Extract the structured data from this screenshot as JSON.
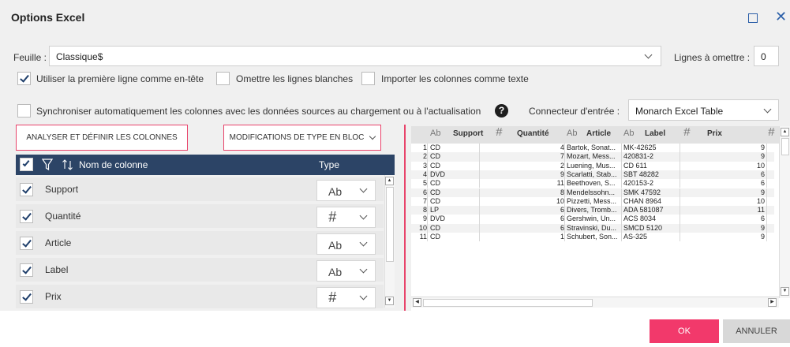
{
  "window": {
    "title": "Options Excel"
  },
  "sheet": {
    "label": "Feuille :",
    "value": "Classique$"
  },
  "skip_lines": {
    "label": "Lignes à omettre :",
    "value": "0"
  },
  "options": {
    "use_header": {
      "label": "Utiliser la première ligne comme en-tête",
      "checked": true
    },
    "skip_blank": {
      "label": "Omettre les lignes blanches",
      "checked": false
    },
    "import_text": {
      "label": "Importer les colonnes comme texte",
      "checked": false
    },
    "sync_columns": {
      "label": "Synchroniser automatiquement les colonnes avec les données sources au chargement ou à l'actualisation",
      "checked": false
    }
  },
  "connector": {
    "label": "Connecteur d'entrée :",
    "value": "Monarch Excel Table"
  },
  "buttons": {
    "analyze": "ANALYSER ET DÉFINIR LES COLONNES",
    "bulk_type": "MODIFICATIONS DE TYPE EN BLOC",
    "ok": "OK",
    "cancel": "ANNULER"
  },
  "column_list": {
    "header_name": "Nom de colonne",
    "header_type": "Type",
    "rows": [
      {
        "name": "Support",
        "type": "Ab"
      },
      {
        "name": "Quantité",
        "type": "#"
      },
      {
        "name": "Article",
        "type": "Ab"
      },
      {
        "name": "Label",
        "type": "Ab"
      },
      {
        "name": "Prix",
        "type": "#"
      }
    ]
  },
  "preview": {
    "columns": [
      {
        "type": "Ab",
        "name": "Support"
      },
      {
        "type": "#",
        "name": "Quantité"
      },
      {
        "type": "Ab",
        "name": "Article"
      },
      {
        "type": "Ab",
        "name": "Label"
      },
      {
        "type": "#",
        "name": "Prix"
      },
      {
        "type": "#",
        "name": ""
      }
    ],
    "rows": [
      [
        "1",
        "CD",
        "4",
        "Bartok, Sonat...",
        "MK-42625",
        "9"
      ],
      [
        "2",
        "CD",
        "7",
        "Mozart, Mess...",
        "420831-2",
        "9"
      ],
      [
        "3",
        "CD",
        "2",
        "Luening, Mus...",
        "CD 611",
        "10"
      ],
      [
        "4",
        "DVD",
        "9",
        "Scarlatti, Stab...",
        "SBT 48282",
        "6"
      ],
      [
        "5",
        "CD",
        "11",
        "Beethoven, S...",
        "420153-2",
        "6"
      ],
      [
        "6",
        "CD",
        "8",
        "Mendelssohn...",
        "SMK 47592",
        "9"
      ],
      [
        "7",
        "CD",
        "10",
        "Pizzetti, Mess...",
        "CHAN 8964",
        "10"
      ],
      [
        "8",
        "LP",
        "6",
        "Divers, Tromb...",
        "ADA 581087",
        "11"
      ],
      [
        "9",
        "DVD",
        "6",
        "Gershwin, Un...",
        "ACS 8034",
        "6"
      ],
      [
        "10",
        "CD",
        "6",
        "Stravinski, Du...",
        "SMCD 5120",
        "9"
      ],
      [
        "11",
        "CD",
        "1",
        "Schubert, Son...",
        "AS-325",
        "9"
      ]
    ]
  },
  "colors": {
    "accent": "#f2396b",
    "header_bg": "#2c4466",
    "outline": "#e8436a"
  }
}
